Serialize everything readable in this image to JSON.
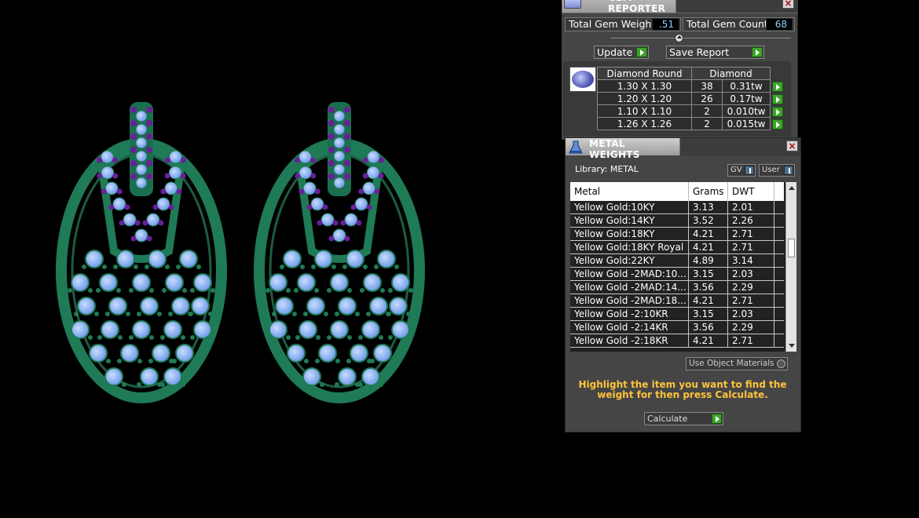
{
  "gem_reporter": {
    "title": "GEM REPORTER",
    "total_weight_label": "Total Gem Weight",
    "total_weight_value": ".51",
    "total_count_label": "Total Gem Count",
    "total_count_value": "68",
    "update_label": "Update",
    "save_report_label": "Save Report",
    "table": {
      "col_shape": "Diamond Round",
      "col_material": "Diamond",
      "rows": [
        {
          "size": "1.30 X 1.30",
          "count": "38",
          "weight": "0.31tw"
        },
        {
          "size": "1.20 X 1.20",
          "count": "26",
          "weight": "0.17tw"
        },
        {
          "size": "1.10 X 1.10",
          "count": "2",
          "weight": "0.010tw"
        },
        {
          "size": "1.26 X 1.26",
          "count": "2",
          "weight": "0.015tw"
        }
      ]
    }
  },
  "metal_weights": {
    "title": "METAL WEIGHTS",
    "library_label": "Library: METAL",
    "gv_label": "GV",
    "user_label": "User",
    "columns": {
      "metal": "Metal",
      "grams": "Grams",
      "dwt": "DWT"
    },
    "rows": [
      {
        "metal": "Yellow Gold:10KY",
        "grams": "3.13",
        "dwt": "2.01"
      },
      {
        "metal": "Yellow Gold:14KY",
        "grams": "3.52",
        "dwt": "2.26"
      },
      {
        "metal": "Yellow Gold:18KY",
        "grams": "4.21",
        "dwt": "2.71"
      },
      {
        "metal": "Yellow Gold:18KY Royal",
        "grams": "4.21",
        "dwt": "2.71"
      },
      {
        "metal": "Yellow Gold:22KY",
        "grams": "4.89",
        "dwt": "3.14"
      },
      {
        "metal": "Yellow Gold -2MAD:10...",
        "grams": "3.15",
        "dwt": "2.03"
      },
      {
        "metal": "Yellow Gold -2MAD:14...",
        "grams": "3.56",
        "dwt": "2.29"
      },
      {
        "metal": "Yellow Gold -2MAD:18...",
        "grams": "4.21",
        "dwt": "2.71"
      },
      {
        "metal": "Yellow Gold -2:10KR",
        "grams": "3.15",
        "dwt": "2.03"
      },
      {
        "metal": "Yellow Gold -2:14KR",
        "grams": "3.56",
        "dwt": "2.29"
      },
      {
        "metal": "Yellow Gold -2:18KR",
        "grams": "4.21",
        "dwt": "2.71"
      }
    ],
    "use_object_materials_label": "Use Object Materials",
    "hint_text": "Highlight the item you want to find the weight for then press Calculate.",
    "calculate_label": "Calculate"
  },
  "colors": {
    "metal_green": "#1f7a56",
    "gem_blue": "#8fb8f5",
    "gem_purple": "#6a1f9a",
    "accent_go": "#3da42b",
    "hint_yellow": "#ffc43a"
  }
}
